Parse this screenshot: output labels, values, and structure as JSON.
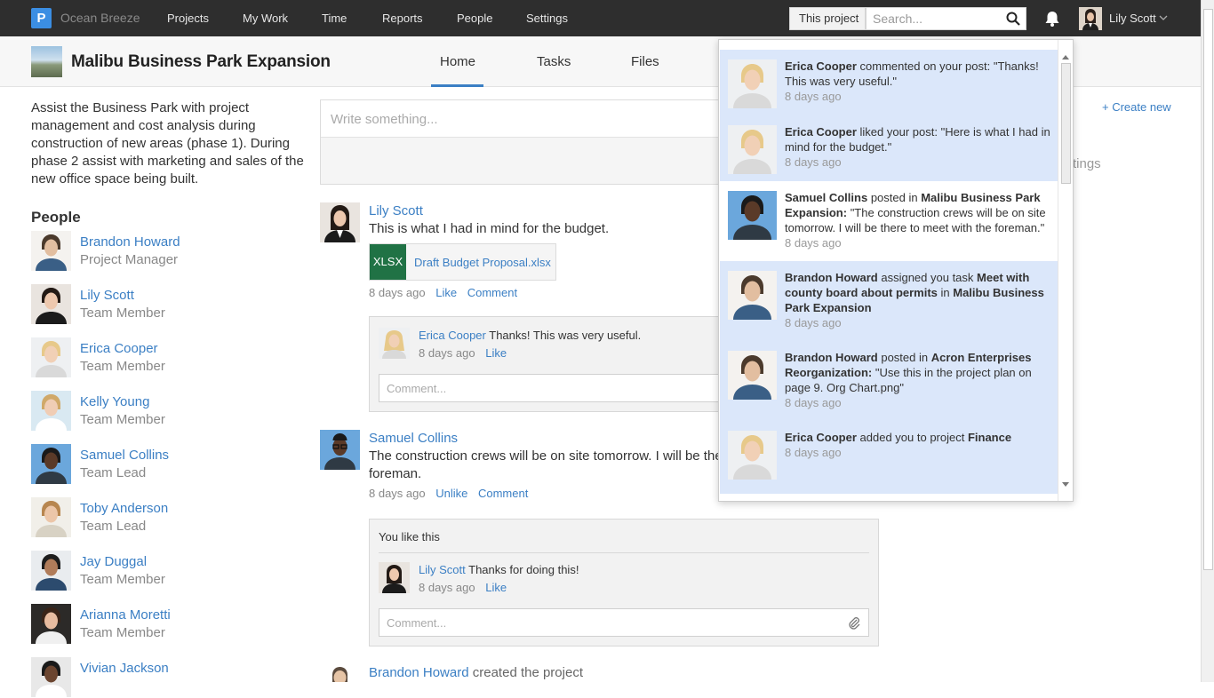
{
  "nav": {
    "logo": "P",
    "brand": "Ocean Breeze",
    "items": [
      "Projects",
      "My Work",
      "Time",
      "Reports",
      "People",
      "Settings"
    ],
    "scope": "This project",
    "search_placeholder": "Search...",
    "user": "Lily Scott"
  },
  "project": {
    "title": "Malibu Business Park Expansion",
    "tabs": [
      "Home",
      "Tasks",
      "Files"
    ],
    "description": "Assist the Business Park with project management and cost analysis during construction of new areas (phase 1). During phase 2 assist with marketing and sales of the new office space being built.",
    "create_new": "+ Create new",
    "settings_fragment": "tings"
  },
  "people": {
    "heading": "People",
    "list": [
      {
        "name": "Brandon Howard",
        "role": "Project Manager"
      },
      {
        "name": "Lily Scott",
        "role": "Team Member"
      },
      {
        "name": "Erica Cooper",
        "role": "Team Member"
      },
      {
        "name": "Kelly Young",
        "role": "Team Member"
      },
      {
        "name": "Samuel Collins",
        "role": "Team Lead"
      },
      {
        "name": "Toby Anderson",
        "role": "Team Lead"
      },
      {
        "name": "Jay Duggal",
        "role": "Team Member"
      },
      {
        "name": "Arianna Moretti",
        "role": "Team Member"
      },
      {
        "name": "Vivian Jackson",
        "role": ""
      }
    ]
  },
  "feed": {
    "post_placeholder": "Write something...",
    "post1": {
      "author": "Lily Scott",
      "text": "This is what I had in mind for the budget.",
      "file_type": "XLSX",
      "file_name": "Draft Budget Proposal.xlsx",
      "time": "8 days ago",
      "like": "Like",
      "comment": "Comment",
      "reply_author": "Erica Cooper",
      "reply_text": "Thanks! This was very useful.",
      "reply_time": "8 days ago",
      "reply_like": "Like",
      "comment_placeholder": "Comment..."
    },
    "post2": {
      "author": "Samuel Collins",
      "text_line1": "The construction crews will be on site tomorrow. I will be the",
      "text_line2": "foreman.",
      "time": "8 days ago",
      "unlike": "Unlike",
      "comment": "Comment",
      "you_like": "You like this",
      "reply_author": "Lily Scott",
      "reply_text": "Thanks for doing this!",
      "reply_time": "8 days ago",
      "reply_like": "Like",
      "comment_placeholder": "Comment..."
    },
    "post3": {
      "author": "Brandon Howard",
      "text": "created the project"
    }
  },
  "notifications": [
    {
      "who": "Erica Cooper",
      "action": " commented on your post: \"Thanks! This was very useful.\"",
      "time": "8 days ago",
      "unread": true
    },
    {
      "who": "Erica Cooper",
      "action": " liked your post: \"Here is what I had in mind for the budget.\"",
      "time": "8 days ago",
      "unread": true
    },
    {
      "who": "Samuel Collins",
      "pre": " posted in ",
      "target": "Malibu Business Park Expansion:",
      "action": " \"The construction crews will be on site tomorrow. I will be there to meet with the foreman.\"",
      "time": "8 days ago",
      "unread": false
    },
    {
      "who": "Brandon Howard",
      "pre": " assigned you task ",
      "target": "Meet with county board about permits",
      "mid": " in ",
      "target2": "Malibu Business Park Expansion",
      "time": "8 days ago",
      "unread": true
    },
    {
      "who": "Brandon Howard",
      "pre": " posted in ",
      "target": "Acron Enterprises Reorganization:",
      "action": " \"Use this in the project plan on page 9. Org Chart.png\"",
      "time": "8 days ago",
      "unread": true
    },
    {
      "who": "Erica Cooper",
      "pre": " added you to project ",
      "target": "Finance",
      "time": "8 days ago",
      "unread": true
    }
  ],
  "colors": {
    "accent": "#3b7fc4",
    "topbar": "#2e2e2e",
    "unread_bg": "#dbe7fa",
    "excel": "#207245"
  }
}
